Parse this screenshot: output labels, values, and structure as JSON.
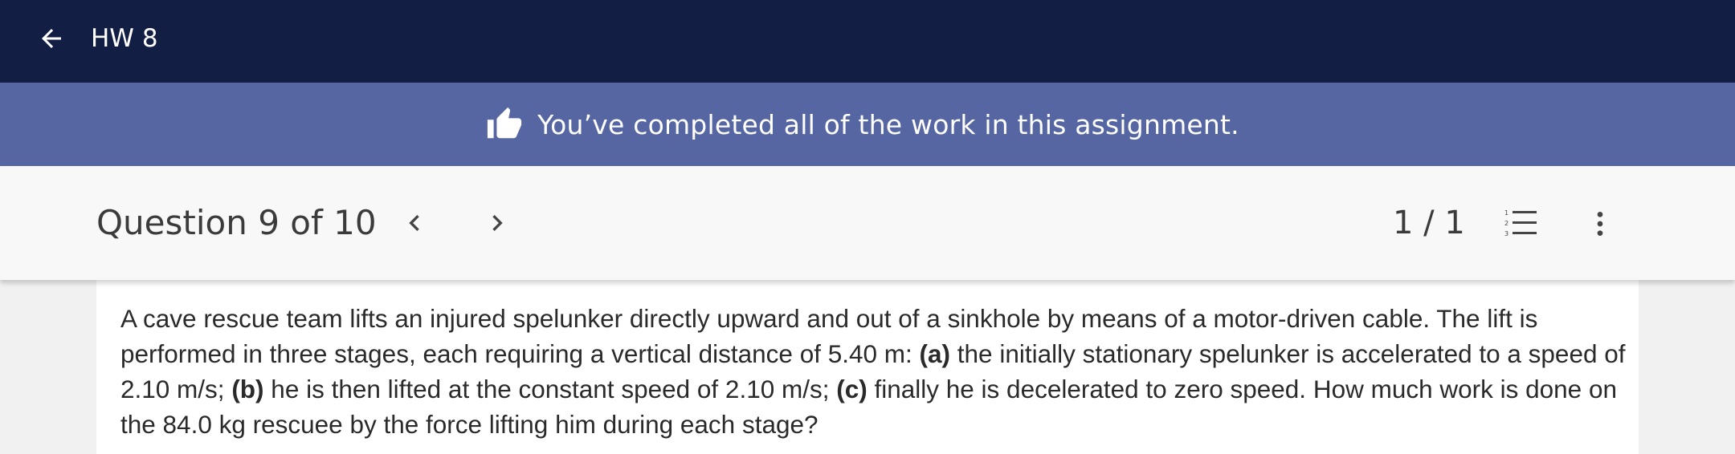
{
  "topbar": {
    "back_icon": "arrow-left-icon",
    "title": "HW 8",
    "background": "#131e45"
  },
  "banner": {
    "icon": "thumbs-up-icon",
    "message": "You’ve completed all of the work in this assignment.",
    "background": "#5666a3"
  },
  "question_bar": {
    "title": "Question 9 of 10",
    "prev_icon": "chevron-left-icon",
    "next_icon": "chevron-right-icon",
    "score": "1 / 1",
    "list_icon": "numbered-list-icon",
    "more_icon": "more-vertical-icon"
  },
  "question": {
    "seg1": "A cave rescue team lifts an injured spelunker directly upward and out of a sinkhole by means of a motor-driven cable. The lift is performed in three stages, each requiring a vertical distance of 5.40 m: ",
    "label_a": "(a)",
    "seg2": " the initially stationary spelunker is accelerated to a speed of 2.10 m/s; ",
    "label_b": "(b)",
    "seg3": " he is then lifted at the constant speed of 2.10 m/s; ",
    "label_c": "(c)",
    "seg4": " finally he is decelerated to zero speed. How much work is done on the 84.0 kg rescuee by the force lifting him during each stage?"
  }
}
